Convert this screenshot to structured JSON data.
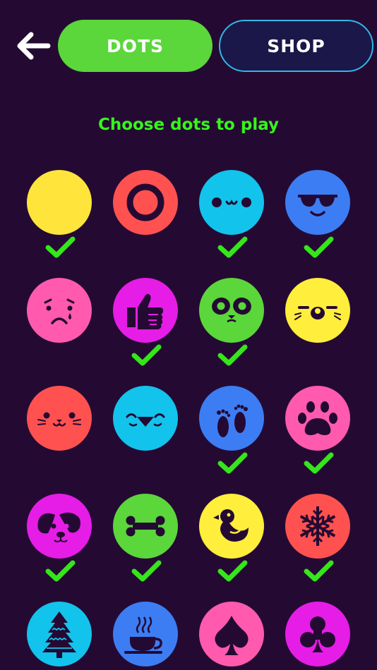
{
  "header": {
    "back_icon": "arrow-left-icon",
    "tabs": [
      {
        "label": "DOTS",
        "active": true,
        "color": "#5bd63b"
      },
      {
        "label": "SHOP",
        "active": false,
        "color": "#1b1748",
        "border": "#2fb8e6"
      }
    ]
  },
  "title": "Choose dots to play",
  "colors": {
    "background": "#240a33",
    "title": "#36f51b",
    "check": "#36e51b",
    "icon_ink": "#240a33"
  },
  "dots": [
    {
      "name": "plain-yellow",
      "color": "#ffe53b",
      "icon": "none",
      "selected": true
    },
    {
      "name": "ring",
      "color": "#ff5250",
      "icon": "ring-icon",
      "selected": false
    },
    {
      "name": "cute-face",
      "color": "#12c3ec",
      "icon": "smile-face-icon",
      "selected": true
    },
    {
      "name": "cool-face",
      "color": "#3c7df4",
      "icon": "sunglasses-icon",
      "selected": true
    },
    {
      "name": "sad-face",
      "color": "#ff5aae",
      "icon": "sad-face-icon",
      "selected": false
    },
    {
      "name": "thumbs-up",
      "color": "#e61de6",
      "icon": "thumbs-up-icon",
      "selected": true
    },
    {
      "name": "panda",
      "color": "#5bd63b",
      "icon": "panda-icon",
      "selected": true
    },
    {
      "name": "bear",
      "color": "#ffee3b",
      "icon": "bear-icon",
      "selected": false
    },
    {
      "name": "cat",
      "color": "#ff5250",
      "icon": "cat-icon",
      "selected": false
    },
    {
      "name": "bird",
      "color": "#12c3ec",
      "icon": "bird-icon",
      "selected": false
    },
    {
      "name": "feet",
      "color": "#3c7df4",
      "icon": "footprints-icon",
      "selected": true
    },
    {
      "name": "paw",
      "color": "#ff5aae",
      "icon": "paw-icon",
      "selected": true
    },
    {
      "name": "dog",
      "color": "#e61de6",
      "icon": "dog-icon",
      "selected": true
    },
    {
      "name": "bone",
      "color": "#5bd63b",
      "icon": "bone-icon",
      "selected": true
    },
    {
      "name": "duck",
      "color": "#ffee3b",
      "icon": "duck-icon",
      "selected": true
    },
    {
      "name": "snowflake",
      "color": "#ff5250",
      "icon": "snowflake-icon",
      "selected": true
    },
    {
      "name": "tree",
      "color": "#12c3ec",
      "icon": "tree-icon",
      "selected": false
    },
    {
      "name": "coffee",
      "color": "#3c7df4",
      "icon": "coffee-icon",
      "selected": false
    },
    {
      "name": "spade",
      "color": "#ff5aae",
      "icon": "spade-icon",
      "selected": false
    },
    {
      "name": "club",
      "color": "#e61de6",
      "icon": "club-icon",
      "selected": false
    }
  ]
}
